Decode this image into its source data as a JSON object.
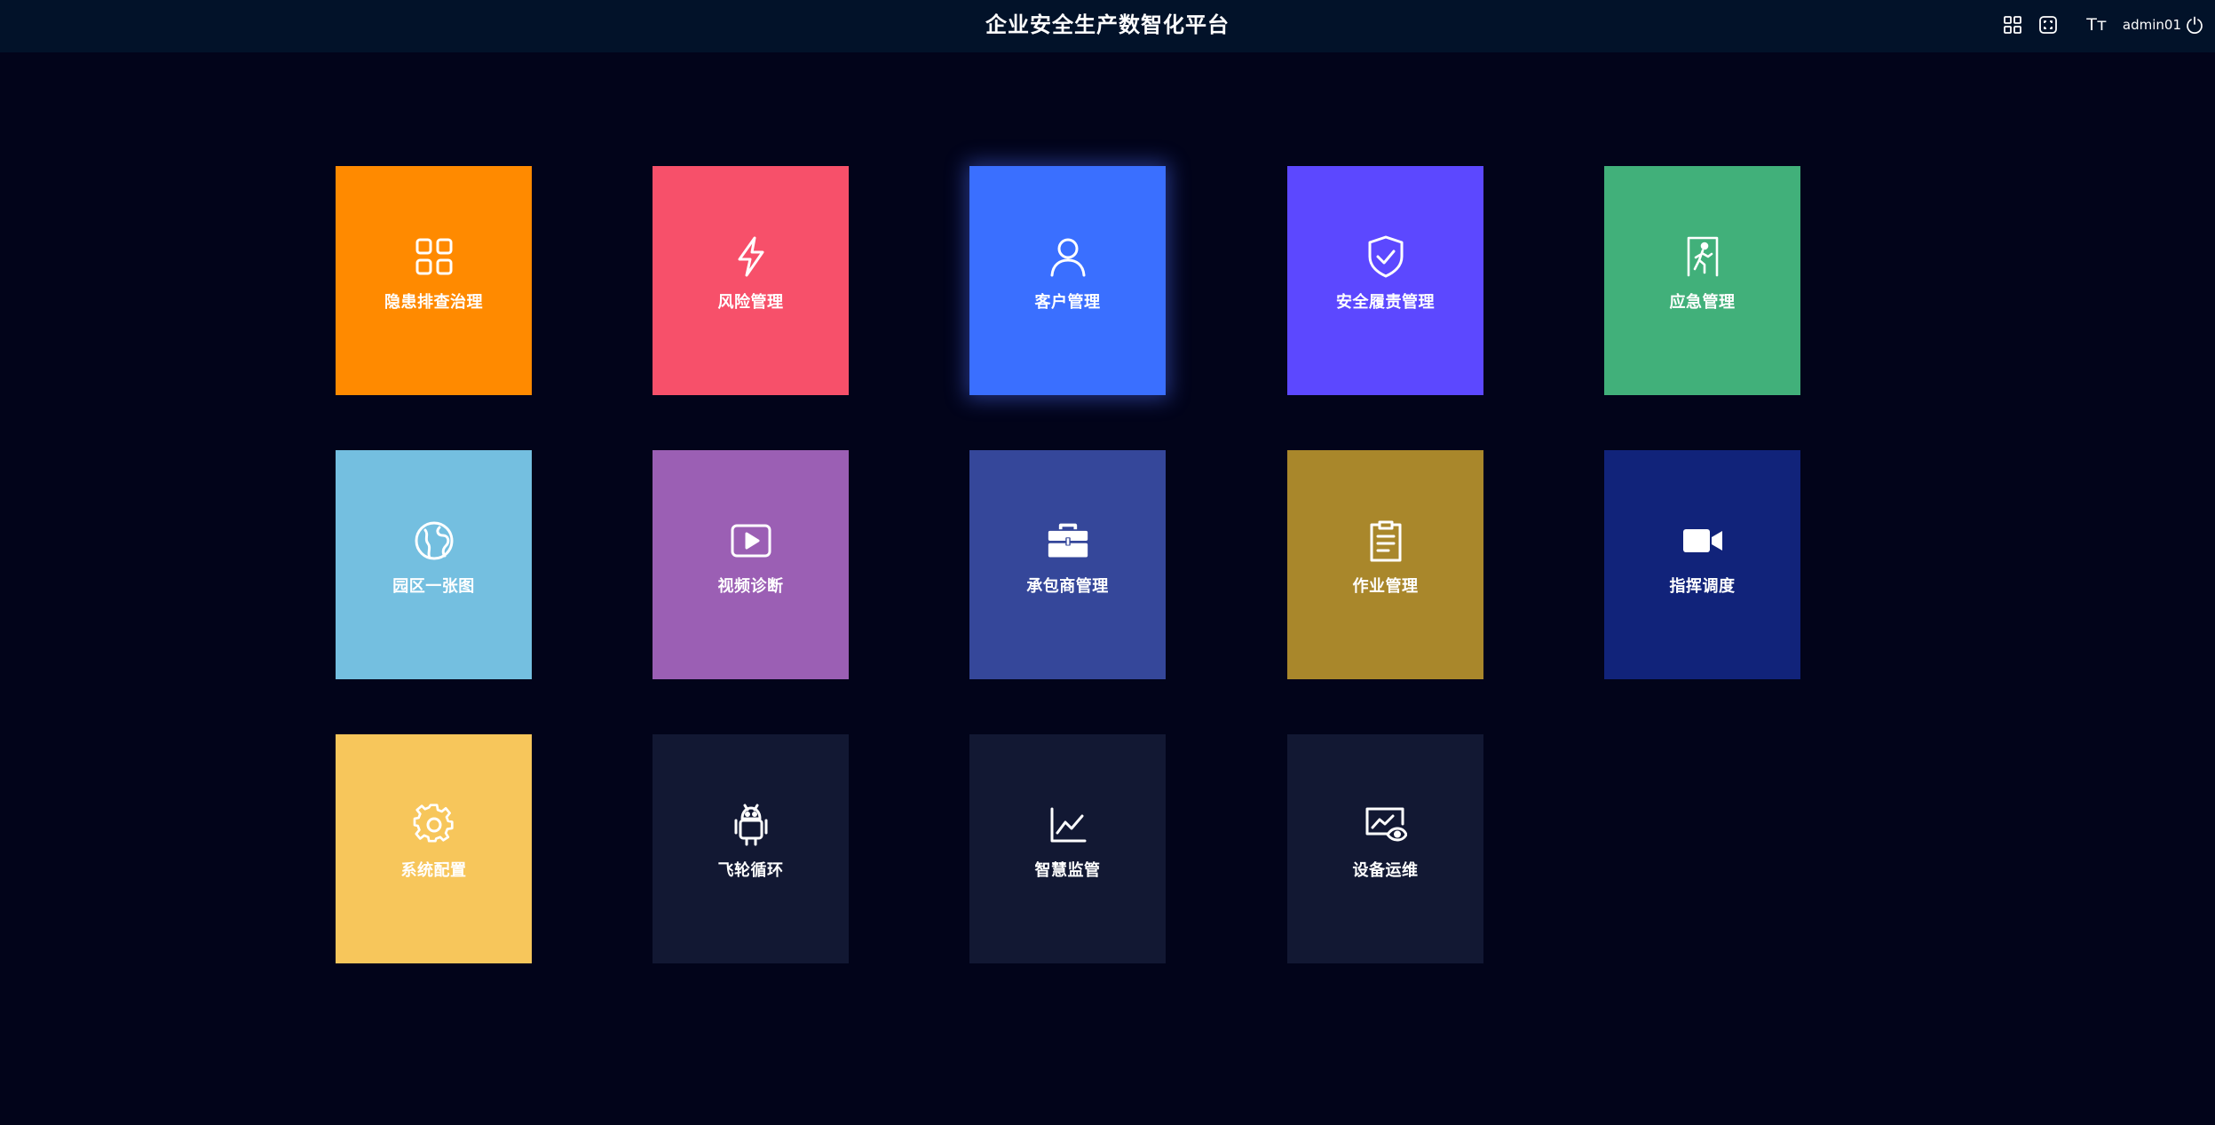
{
  "header": {
    "title": "企业安全生产数智化平台",
    "tools": {
      "apps_icon": "grid-icon",
      "fullscreen_icon": "fullscreen-icon",
      "font_size_label": "Tт",
      "username": "admin01",
      "logout_icon": "power-icon"
    }
  },
  "modules": [
    {
      "label": "隐患排查治理",
      "icon": "grid-icon",
      "color": "#ff8a00"
    },
    {
      "label": "风险管理",
      "icon": "lightning-icon",
      "color": "#f7506a"
    },
    {
      "label": "客户管理",
      "icon": "user-icon",
      "color": "#3a6fff"
    },
    {
      "label": "安全履责管理",
      "icon": "shield-check-icon",
      "color": "#5c48ff"
    },
    {
      "label": "应急管理",
      "icon": "emergency-exit-icon",
      "color": "#41b07a"
    },
    {
      "label": "园区一张图",
      "icon": "map-globe-icon",
      "color": "#74bfe0"
    },
    {
      "label": "视频诊断",
      "icon": "play-icon",
      "color": "#9b5fb4"
    },
    {
      "label": "承包商管理",
      "icon": "toolbox-icon",
      "color": "#35479a"
    },
    {
      "label": "作业管理",
      "icon": "clipboard-icon",
      "color": "#a9872b"
    },
    {
      "label": "指挥调度",
      "icon": "video-camera-icon",
      "color": "#11237a"
    },
    {
      "label": "系统配置",
      "icon": "gear-icon",
      "color": "#f7c65b"
    },
    {
      "label": "飞轮循环",
      "icon": "android-icon",
      "color": "#121833"
    },
    {
      "label": "智慧监管",
      "icon": "line-chart-icon",
      "color": "#121833"
    },
    {
      "label": "设备运维",
      "icon": "monitor-eye-icon",
      "color": "#121833"
    }
  ]
}
